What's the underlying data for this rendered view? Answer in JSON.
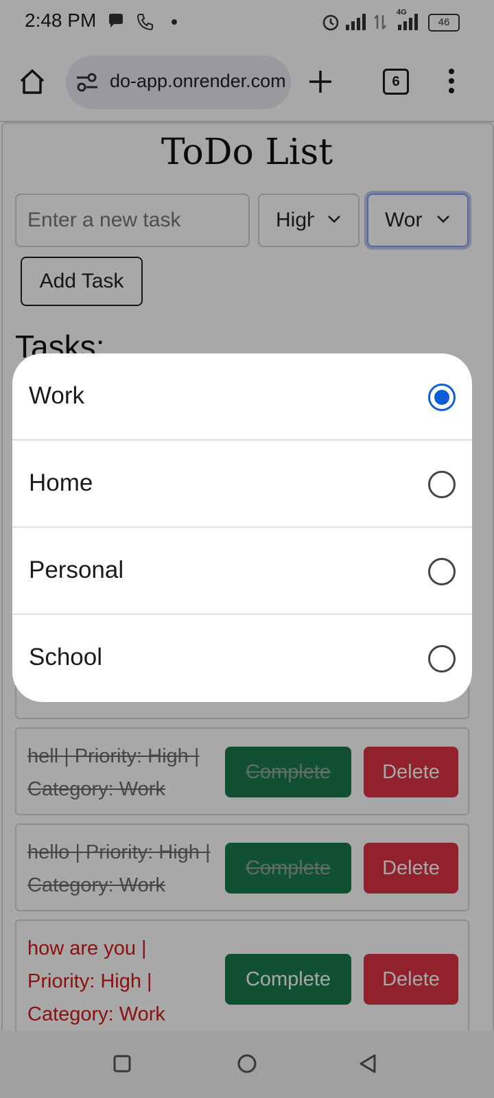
{
  "status_bar": {
    "time": "2:48 PM",
    "network": "4G",
    "battery": "46"
  },
  "browser": {
    "url": "do-app.onrender.com",
    "tab_count": "6"
  },
  "app": {
    "title": "ToDo List",
    "task_input_placeholder": "Enter a new task",
    "priority_value": "High",
    "category_value": "Work",
    "add_button": "Add Task",
    "tasks_heading": "Tasks:"
  },
  "tasks": [
    {
      "line1": "hell | Priority: High |",
      "line2": "Category: Work",
      "complete_label": "Complete",
      "delete_label": "Delete",
      "completed": true
    },
    {
      "line1": "hello | Priority: High |",
      "line2": "Category: Work",
      "complete_label": "Complete",
      "delete_label": "Delete",
      "completed": true
    },
    {
      "line1": "how are you |",
      "line2": "Priority: High |",
      "line3": "Category: Work",
      "complete_label": "Complete",
      "delete_label": "Delete",
      "completed": false
    }
  ],
  "category_picker": {
    "options": [
      {
        "label": "Work",
        "selected": true
      },
      {
        "label": "Home",
        "selected": false
      },
      {
        "label": "Personal",
        "selected": false
      },
      {
        "label": "School",
        "selected": false
      }
    ]
  },
  "colors": {
    "accent": "#0b5ed7",
    "complete": "#1a7a4c",
    "delete": "#dc3545",
    "active_task": "#d11a1a"
  }
}
